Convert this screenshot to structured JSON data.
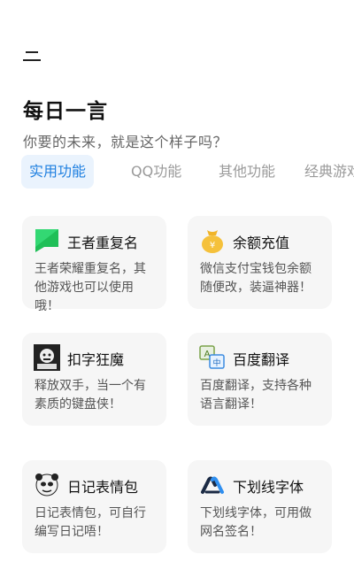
{
  "header": {
    "title": "每日一言",
    "subtitle": "你要的未来，就是这个样子吗？"
  },
  "tabs": [
    {
      "label": "实用功能",
      "active": true
    },
    {
      "label": "QQ功能",
      "active": false
    },
    {
      "label": "其他功能",
      "active": false
    },
    {
      "label": "经典游戏",
      "active": false
    }
  ],
  "cards": [
    {
      "icon": "green-flag-icon",
      "title": "王者重复名",
      "desc": "王者荣耀重复名，其他游戏也可以使用哦！"
    },
    {
      "icon": "money-bag-icon",
      "title": "余额充值",
      "desc": "微信支付宝钱包余额随便改，装逼神器！"
    },
    {
      "icon": "meme-face-icon",
      "title": "扣字狂魔",
      "desc": "释放双手，当一个有素质的键盘侠！"
    },
    {
      "icon": "translate-icon",
      "title": "百度翻译",
      "desc": "百度翻译，支持各种语言翻译！"
    },
    {
      "icon": "panda-meme-icon",
      "title": "日记表情包",
      "desc": "日记表情包，可自行编写日记唔！"
    },
    {
      "icon": "ai-logo-icon",
      "title": "下划线字体",
      "desc": "下划线字体，可用做网名签名！"
    }
  ],
  "colors": {
    "accent": "#1e7fe0",
    "tab_active_bg": "#eaf3fd",
    "card_bg": "#f6f6f6"
  }
}
